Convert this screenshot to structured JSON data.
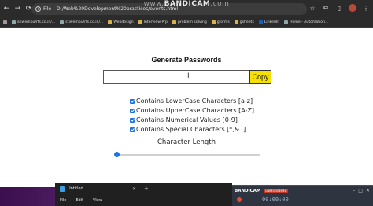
{
  "watermark": {
    "prefix": "www.",
    "brand": "BANDICAM",
    "suffix": ".com"
  },
  "browser": {
    "back": "←",
    "forward": "→",
    "reload": "⟳",
    "chip": "File",
    "url": "D:/Web%20Development%20practices/events.html",
    "bookmarks": [
      {
        "label": "",
        "icon": "apps-grid"
      },
      {
        "label": "sriwembu/rfs.co.in/...",
        "icon": "site"
      },
      {
        "label": "sriwembu/rfs.co.in/...",
        "icon": "site"
      },
      {
        "label": "Webdesign",
        "icon": "folder"
      },
      {
        "label": "Interview Prp",
        "icon": "folder"
      },
      {
        "label": "problem solving",
        "icon": "folder"
      },
      {
        "label": "gforms",
        "icon": "folder"
      },
      {
        "label": "gsheets",
        "icon": "folder"
      },
      {
        "label": "LinkedIn",
        "icon": "linkedin"
      },
      {
        "label": "Home - Automation...",
        "icon": "site"
      }
    ]
  },
  "page": {
    "heading": "Generate Passwords",
    "password_value": "",
    "copy_label": "Copy",
    "options": [
      {
        "label": "Contains LowerCase Characters [a-z]",
        "checked": true
      },
      {
        "label": "Contains UpperCase Characters [A-Z]",
        "checked": true
      },
      {
        "label": "Contains Numerical Values [0-9]",
        "checked": true
      },
      {
        "label": "Contains Special Characters [*,&..]",
        "checked": true
      }
    ],
    "length_label": "Character Length",
    "length_slider_fraction": 0.0
  },
  "notepad": {
    "tab_title": "Untitled",
    "close": "✕",
    "plus": "+",
    "menu": [
      "File",
      "Edit",
      "View"
    ]
  },
  "bandicam": {
    "title": "BANDICAM",
    "badge": "UNREGISTERED",
    "time": "00:00:00",
    "buttons": [
      "–",
      "□",
      "✕"
    ]
  }
}
